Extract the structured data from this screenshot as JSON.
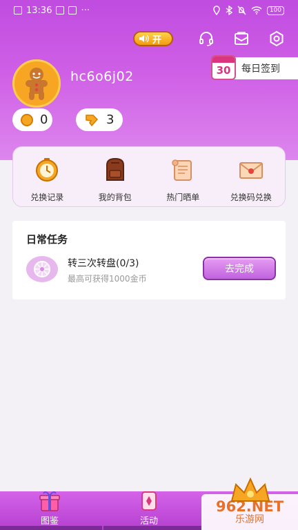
{
  "status_bar": {
    "time": "13:36",
    "dots": "···",
    "battery": "100"
  },
  "header": {
    "sound_toggle": "开",
    "icons": [
      "headset-icon",
      "mail-icon",
      "settings-icon"
    ],
    "username": "hc6o6j02",
    "checkin": {
      "day": "30",
      "label": "每日签到"
    },
    "coins": "0",
    "tickets": "3"
  },
  "features": [
    {
      "label": "兑换记录",
      "icon": "clock-icon"
    },
    {
      "label": "我的背包",
      "icon": "backpack-icon"
    },
    {
      "label": "热门晒单",
      "icon": "scroll-icon"
    },
    {
      "label": "兑换码兑换",
      "icon": "envelope-icon"
    }
  ],
  "tasks": {
    "title": "日常任务",
    "items": [
      {
        "name": "转三次转盘(0/3)",
        "desc_prefix": "最高可获得",
        "desc_amount": "1000",
        "desc_suffix": "金币",
        "button": "去完成"
      }
    ]
  },
  "bottom_nav": [
    {
      "label": "图鉴",
      "icon": "gift-icon"
    },
    {
      "label": "活动",
      "icon": "card-icon"
    }
  ],
  "watermark": {
    "top": "962.NET",
    "bottom": "乐游网"
  },
  "colors": {
    "header": "#c04ce0",
    "accent": "#c062de",
    "coin": "#f5a623"
  }
}
